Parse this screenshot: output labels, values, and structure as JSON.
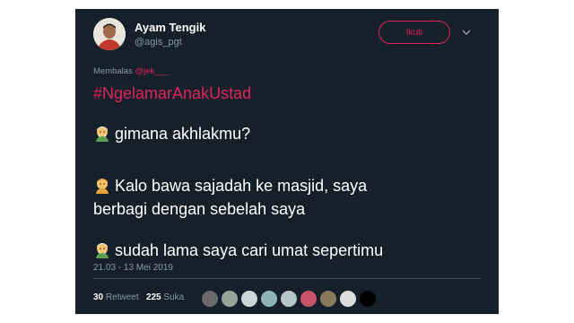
{
  "tweet": {
    "display_name": "Ayam Tengik",
    "handle": "@agis_pgt",
    "follow_label": "Ikuti",
    "reply_prefix": "Membalas",
    "reply_mention": "@jek___",
    "hashtag": "#NgelamarAnakUstad",
    "lines": [
      {
        "emoji": "older-man-emoji",
        "text": "gimana akhlakmu?"
      },
      {
        "emoji": "man-emoji",
        "text": "Kalo bawa sajadah ke masjid, saya"
      },
      {
        "emoji": null,
        "text": "berbagi dengan sebelah saya"
      },
      {
        "emoji": "older-man-emoji",
        "text": "sudah lama saya cari umat sepertimu"
      }
    ],
    "timestamp": "21.03 - 13 Mei 2019",
    "retweet_count": "30",
    "retweet_label": "Retweet",
    "like_count": "225",
    "like_label": "Suka",
    "liker_colors": [
      "#6b6b6b",
      "#9aa39a",
      "#cfd6d8",
      "#8fb3b8",
      "#b7c4c9",
      "#c7526a",
      "#8a7a5a",
      "#dcdcdc",
      "#000000"
    ]
  },
  "colors": {
    "background": "#15202b",
    "accent": "#e0245e",
    "secondary_text": "#8899a6"
  }
}
